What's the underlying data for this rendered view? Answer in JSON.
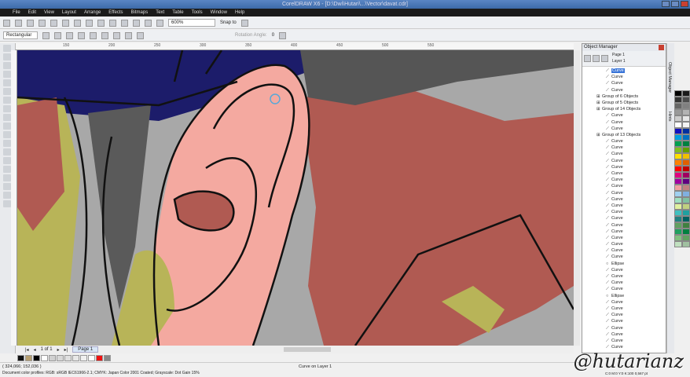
{
  "title": "CorelDRAW X6 - [D:\\Dwi\\Hutari\\...\\Vector\\davat.cdr]",
  "menu": [
    "File",
    "Edit",
    "View",
    "Layout",
    "Arrange",
    "Effects",
    "Bitmaps",
    "Text",
    "Table",
    "Tools",
    "Window",
    "Help"
  ],
  "toolbar": {
    "zoom_value": "600%",
    "snap_label": "Snap to"
  },
  "propbar": {
    "shape_select": "Rectangular",
    "rotate_label": "Rotation Angle:",
    "rotate_value": "0"
  },
  "ruler_ticks": [
    "150",
    "200",
    "250",
    "300",
    "350",
    "400",
    "450",
    "500",
    "550"
  ],
  "page_nav": {
    "page_count": "1 of 1",
    "page_tab": "Page 1"
  },
  "status": {
    "coords": "( 324,066; 152,036 )",
    "object_info": "Curve on Layer 1",
    "color_profiles": "Document color profiles: RGB: sRGB IEC61966-2.1; CMYK: Japan Color 2001 Coated; Grayscale: Dot Gain 15%",
    "fill_info": "C:0 M:0 Y:0 K:100  0,567 pt"
  },
  "object_manager": {
    "title": "Object Manager",
    "page": "Page 1",
    "layer": "Layer 1",
    "items": [
      {
        "label": "Curve",
        "type": "curve",
        "selected": true
      },
      {
        "label": "Curve",
        "type": "curve"
      },
      {
        "label": "Curve",
        "type": "curve"
      },
      {
        "label": "Curve",
        "type": "curve"
      },
      {
        "label": "Group of 6 Objects",
        "type": "group"
      },
      {
        "label": "Group of 5 Objects",
        "type": "group"
      },
      {
        "label": "Group of 14 Objects",
        "type": "group"
      },
      {
        "label": "Curve",
        "type": "curve"
      },
      {
        "label": "Curve",
        "type": "curve"
      },
      {
        "label": "Curve",
        "type": "curve"
      },
      {
        "label": "Group of 13 Objects",
        "type": "group"
      },
      {
        "label": "Curve",
        "type": "curve"
      },
      {
        "label": "Curve",
        "type": "curve"
      },
      {
        "label": "Curve",
        "type": "curve"
      },
      {
        "label": "Curve",
        "type": "curve"
      },
      {
        "label": "Curve",
        "type": "curve"
      },
      {
        "label": "Curve",
        "type": "curve"
      },
      {
        "label": "Curve",
        "type": "curve"
      },
      {
        "label": "Curve",
        "type": "curve"
      },
      {
        "label": "Curve",
        "type": "curve"
      },
      {
        "label": "Curve",
        "type": "curve"
      },
      {
        "label": "Curve",
        "type": "curve"
      },
      {
        "label": "Curve",
        "type": "curve"
      },
      {
        "label": "Curve",
        "type": "curve"
      },
      {
        "label": "Curve",
        "type": "curve"
      },
      {
        "label": "Curve",
        "type": "curve"
      },
      {
        "label": "Curve",
        "type": "curve"
      },
      {
        "label": "Curve",
        "type": "curve"
      },
      {
        "label": "Curve",
        "type": "curve"
      },
      {
        "label": "Curve",
        "type": "curve"
      },
      {
        "label": "Ellipse",
        "type": "ellipse"
      },
      {
        "label": "Curve",
        "type": "curve"
      },
      {
        "label": "Curve",
        "type": "curve"
      },
      {
        "label": "Curve",
        "type": "curve"
      },
      {
        "label": "Curve",
        "type": "curve"
      },
      {
        "label": "Ellipse",
        "type": "ellipse"
      },
      {
        "label": "Curve",
        "type": "curve"
      },
      {
        "label": "Curve",
        "type": "curve"
      },
      {
        "label": "Curve",
        "type": "curve"
      },
      {
        "label": "Curve",
        "type": "curve"
      },
      {
        "label": "Curve",
        "type": "curve"
      },
      {
        "label": "Curve",
        "type": "curve"
      },
      {
        "label": "Curve",
        "type": "curve"
      },
      {
        "label": "Curve",
        "type": "curve"
      }
    ]
  },
  "dock_tabs": [
    "Object Manager",
    "Hints"
  ],
  "watermark": "@hutarianz",
  "doc_palette": [
    "#111111",
    "#b8a070",
    "#000000",
    "#ffffff",
    "#d0d0d0",
    "#d8d8d8",
    "#e0e0e0",
    "#e8e8e8",
    "#f0f0f0",
    "#ffffff",
    "#ee1111",
    "#888888"
  ],
  "palette": [
    "#000000",
    "#1a1a1a",
    "#333333",
    "#4d4d4d",
    "#666666",
    "#808080",
    "#999999",
    "#b3b3b3",
    "#cccccc",
    "#e6e6e6",
    "#ffffff",
    "#f5f5f5",
    "#1010c0",
    "#0030a0",
    "#00a0e0",
    "#0070c0",
    "#00a050",
    "#008040",
    "#80c020",
    "#60a000",
    "#ffe000",
    "#f0c000",
    "#ff8000",
    "#e06000",
    "#ff0000",
    "#c00000",
    "#e00080",
    "#a00060",
    "#a000a0",
    "#600080",
    "#f0a0a0",
    "#c08080",
    "#a0d0f0",
    "#80b0e0",
    "#a0e0c0",
    "#80c0a0",
    "#e0f0a0",
    "#c0d080",
    "#40c0c0",
    "#20a0a0",
    "#208080",
    "#006060",
    "#60a060",
    "#408040",
    "#20a060",
    "#008040",
    "#80c080",
    "#60a060",
    "#c0e0c0",
    "#a0c0a0"
  ]
}
